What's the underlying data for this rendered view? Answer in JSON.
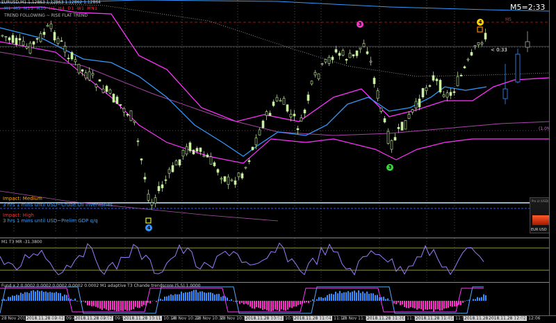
{
  "symbol": "EURUSD,M1  1.12863 1.12863 1.12862 1.12864",
  "timeframes": [
    "M1",
    "M5",
    "M15",
    "M30",
    "H1",
    "H4",
    "D1",
    "W1",
    "MN1"
  ],
  "trend_label": "TREND FOLLOWING ~ RISE FLAT TREND",
  "timer": "M5=2:33",
  "m5_label": "M5",
  "price_countdown": "< 0:33",
  "pct_label": "(1.0%)",
  "news": [
    {
      "impact": "Impact: Medium",
      "text": "3 hrs 1 mins until USD~Crude Oil Inventories"
    },
    {
      "impact": "Impact: High",
      "text": "3 hrs 1 mins until USD~Prelim GDP q/q"
    }
  ],
  "markers": [
    {
      "label": "4",
      "color": "#ffd400"
    },
    {
      "label": "3",
      "color": "#ff33cc"
    },
    {
      "label": "3",
      "color": "#33dd33"
    },
    {
      "label": "4",
      "color": "#3399ff"
    }
  ],
  "widget": {
    "title": "Pro Lt (USD)",
    "label": "EUR USD"
  },
  "osc_label": "M1  T3 MR  -31.3800",
  "hist_label": "Fund x 2  0.0002  0.0002  0.0002  0.0002  0.0002   M1  adaptive T3 Chande  trendscore (5,5)  1.0000",
  "time_labels": [
    "28 Nov 2018",
    "2018.11.28 09:42",
    "28 Nov 09:46",
    "2018.11.28 09:57",
    "28 Nov 09:58",
    "2018.11.28 10:11",
    "28 Nov 10:14",
    "28 Nov 10:22",
    "28 Nov 10:30",
    "28 Nov 10:38",
    "2018.11.28 10:52",
    "28 Nov 10:54",
    "2018.11.28 11:04",
    "28 Nov 11:10",
    "28 Nov 11:18",
    "2018.11.28 11:26",
    "28 Nov 11:34",
    "2018.11.28 11:45",
    "28 Nov 11:50",
    "2018.11.28 11:58",
    "2018.11.28 12:02",
    "28 Nov 12:06"
  ],
  "colors": {
    "candle": "#c8f0a0",
    "ma_blue": "#3399ff",
    "band_magenta": "#ff33ff",
    "osc_line": "#9a7cff",
    "hist_magenta": "#ff33cc",
    "hist_blue": "#3a8fff"
  }
}
